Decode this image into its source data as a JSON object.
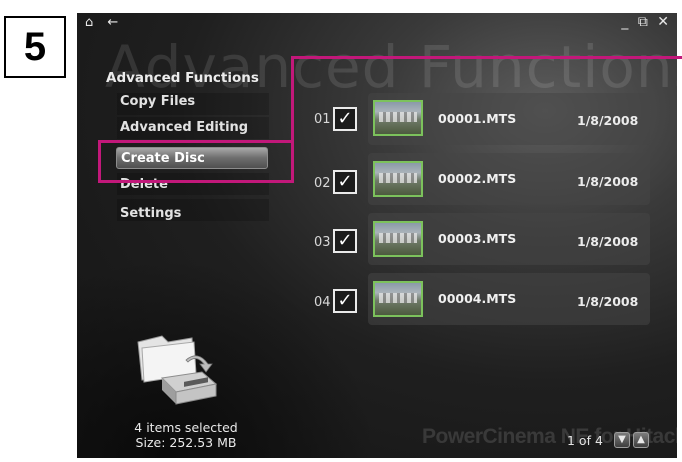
{
  "step": {
    "number": "5"
  },
  "window": {
    "watermark": "Advanced Functions",
    "controls": {
      "minimize": "_",
      "restore": "⧉",
      "close": "✕"
    },
    "nav_icons": [
      "home-icon",
      "back-icon"
    ]
  },
  "sidebar": {
    "title": "Advanced Functions",
    "items": [
      {
        "label": "Copy Files",
        "selected": false
      },
      {
        "label": "Advanced Editing",
        "selected": false
      },
      {
        "label": "Create Disc",
        "selected": true
      },
      {
        "label": "Delete",
        "selected": false
      },
      {
        "label": "Settings",
        "selected": false
      }
    ]
  },
  "files": [
    {
      "num": "01",
      "checked": true,
      "name": "00001.MTS",
      "date": "1/8/2008"
    },
    {
      "num": "02",
      "checked": true,
      "name": "00002.MTS",
      "date": "1/8/2008"
    },
    {
      "num": "03",
      "checked": true,
      "name": "00003.MTS",
      "date": "1/8/2008"
    },
    {
      "num": "04",
      "checked": true,
      "name": "00004.MTS",
      "date": "1/8/2008"
    }
  ],
  "status": {
    "items_selected": "4 items selected",
    "size": "Size: 252.53 MB"
  },
  "pager": {
    "text": "1 of 4"
  },
  "brand": "PowerCinema NE for Hitachi",
  "colors": {
    "highlight": "#c2187a",
    "thumb_border": "#7cc25c"
  }
}
